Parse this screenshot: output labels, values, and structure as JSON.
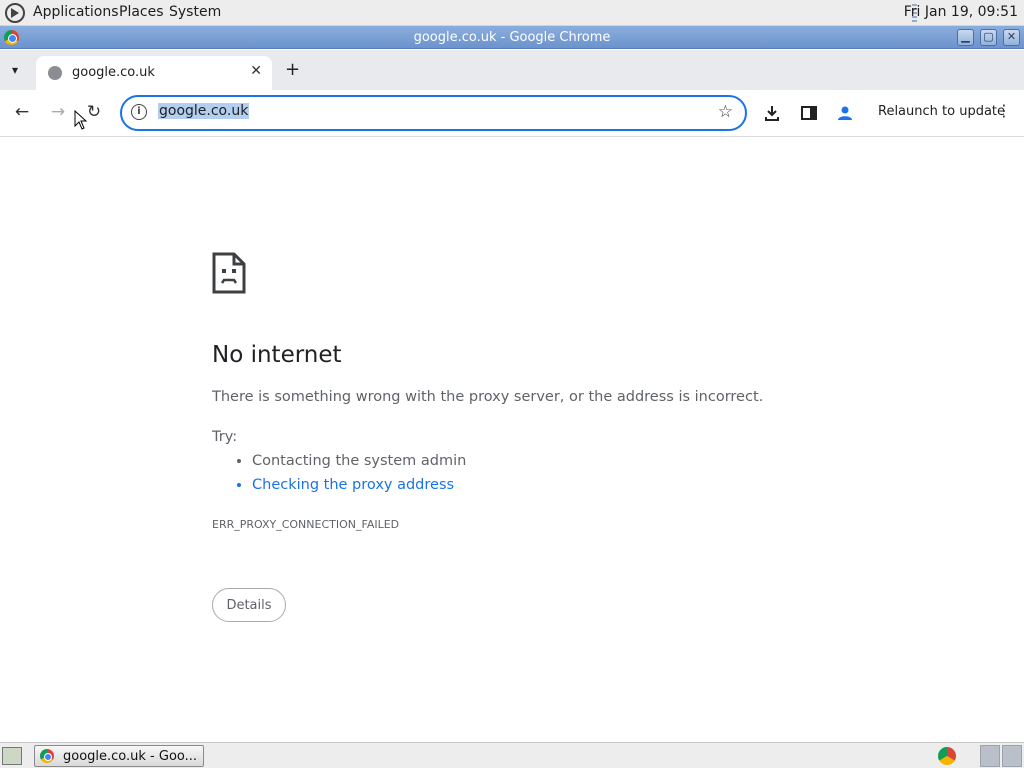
{
  "panel": {
    "menus": [
      "Applications",
      "Places",
      "System"
    ],
    "clock": "Fri Jan 19, 09:51"
  },
  "window": {
    "title": "google.co.uk - Google Chrome",
    "buttons": [
      "minimize",
      "maximize",
      "close"
    ]
  },
  "tabs": [
    {
      "label": "google.co.uk",
      "active": true
    }
  ],
  "toolbar": {
    "url": "google.co.uk",
    "relaunch_label": "Relaunch to update"
  },
  "error_page": {
    "heading": "No internet",
    "message": "There is something wrong with the proxy server, or the address is incorrect.",
    "try_label": "Try:",
    "suggestions": [
      {
        "text": "Contacting the system admin",
        "link": false
      },
      {
        "text": "Checking the proxy address",
        "link": true
      }
    ],
    "error_code": "ERR_PROXY_CONNECTION_FAILED",
    "details_button": "Details"
  },
  "taskbar": {
    "window_button": "google.co.uk - Goo..."
  },
  "colors": {
    "accent": "#1a73e8",
    "titlebar": "#7aa0d6",
    "muted_text": "#5f6368"
  }
}
